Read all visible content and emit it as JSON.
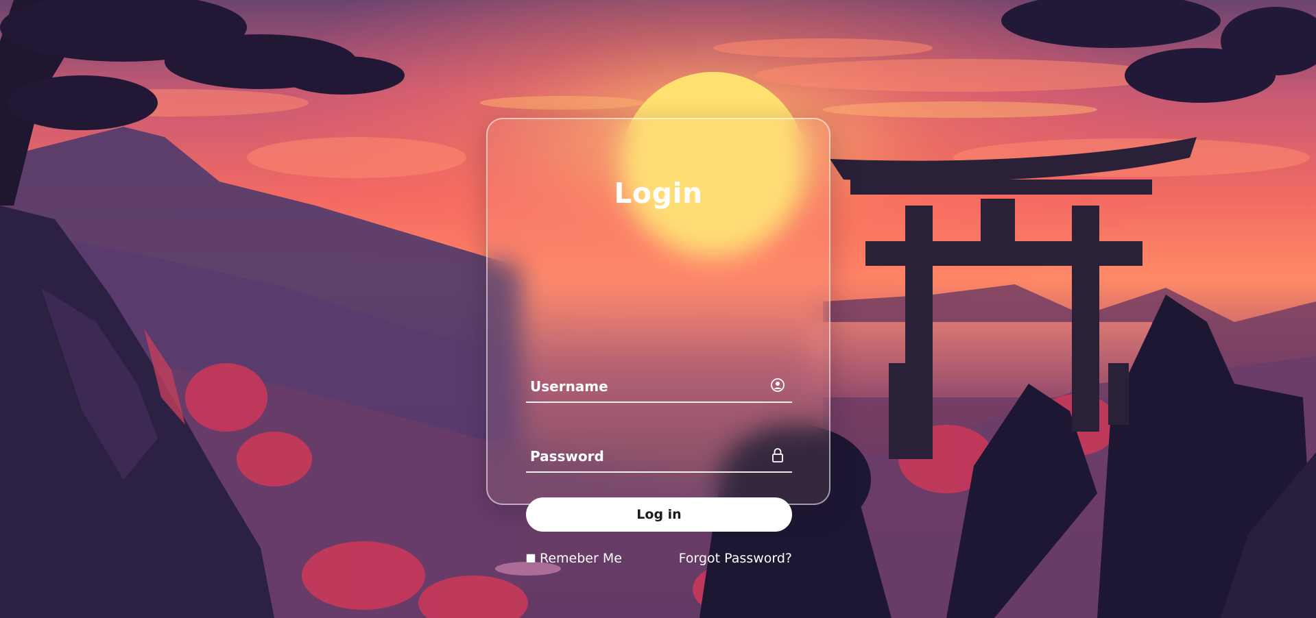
{
  "login": {
    "title": "Login",
    "username_placeholder": "Username",
    "password_placeholder": "Password",
    "login_button_label": "Log in",
    "remember_label": "Remeber Me",
    "forgot_label": "Forgot Password?"
  },
  "icons": {
    "username": "user-circle-icon",
    "password": "lock-icon"
  },
  "colors": {
    "sky_top": "#5b3a63",
    "sky_glow": "#ff6a6a",
    "sun": "#ffe070",
    "mountain": "#4a3663",
    "foliage": "#d13a5b",
    "dark": "#1e1733",
    "button_bg": "#ffffff"
  }
}
